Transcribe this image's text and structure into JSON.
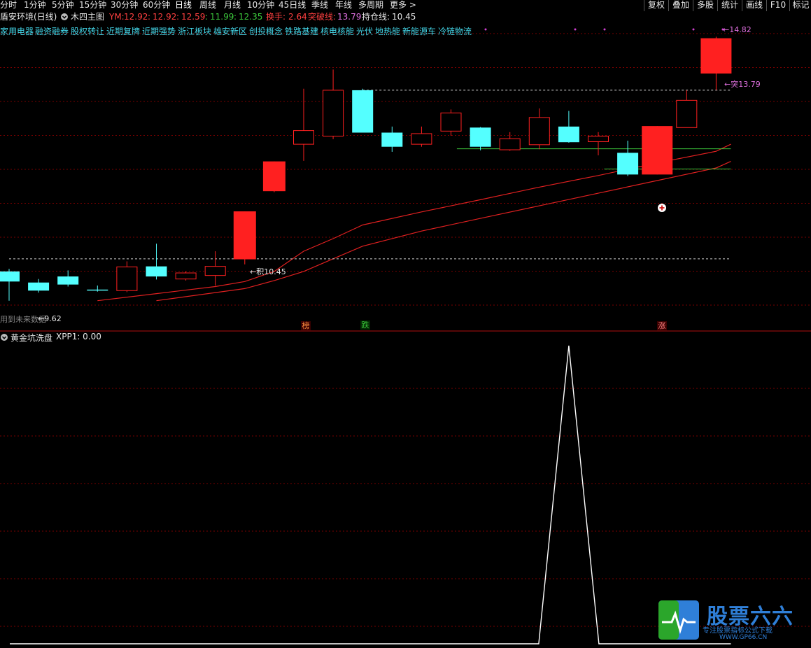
{
  "toolbar": {
    "periods": [
      "分时",
      "1分钟",
      "5分钟",
      "15分钟",
      "30分钟",
      "60分钟",
      "日线",
      "周线",
      "月线",
      "10分钟",
      "45日线",
      "季线",
      "年线",
      "多周期",
      "更多 >"
    ],
    "right_buttons": [
      "复权",
      "叠加",
      "多股",
      "统计",
      "画线",
      "F10",
      "标记"
    ]
  },
  "header": {
    "stock_title": "盾安环境(日线)",
    "indicator_name": "木四主图",
    "ym_label": "YM:",
    "ym_values": [
      "12.92",
      "12.92",
      "12.59",
      "11.99",
      "12.35"
    ],
    "turnover_label": "换手:",
    "turnover_value": "2.64",
    "breakout_label": "突破线:",
    "breakout_value": "13.79",
    "hold_label": "持仓线:",
    "hold_value": "10.45"
  },
  "concepts": [
    "家用电器",
    "融资融券",
    "股权转让",
    "近期复牌",
    "近期强势",
    "浙江板块",
    "雄安新区",
    "创投概念",
    "铁路基建",
    "核电核能",
    "光伏",
    "地热能",
    "新能源车",
    "冷链物流"
  ],
  "price_labels": {
    "high": "14.82",
    "breakout": "突13.79",
    "hold": "积10.45",
    "low": "9.62",
    "future_note": "用到未来数据"
  },
  "signals": {
    "s1": "榜",
    "s2": "跌",
    "s3": "涨"
  },
  "sub_chart": {
    "title": "黄金坑洗盘",
    "series_label": "XPP1: 0.00"
  },
  "logo": {
    "name": "股票六六",
    "tagline": "专注股票指标公式下载",
    "url": "WWW.GP66.CN"
  },
  "colors": {
    "up": "#ff2020",
    "down": "#54ffff",
    "grid": "#7a0000",
    "ma": "#e02020",
    "green_line": "#3cc83c",
    "white": "#ffffff"
  },
  "chart_data": [
    {
      "type": "candlestick",
      "title": "木四主图",
      "ylim": [
        9.2,
        15.3
      ],
      "candles": [
        {
          "o": 10.2,
          "c": 10.0,
          "h": 10.25,
          "l": 9.62
        },
        {
          "o": 9.98,
          "c": 9.82,
          "h": 10.05,
          "l": 9.78
        },
        {
          "o": 10.1,
          "c": 9.94,
          "h": 10.22,
          "l": 9.9
        },
        {
          "o": 9.84,
          "c": 9.82,
          "h": 9.92,
          "l": 9.8
        },
        {
          "o": 9.82,
          "c": 10.29,
          "h": 10.4,
          "l": 9.79
        },
        {
          "o": 10.3,
          "c": 10.1,
          "h": 10.75,
          "l": 10.04
        },
        {
          "o": 10.05,
          "c": 10.17,
          "h": 10.2,
          "l": 10.02
        },
        {
          "o": 10.12,
          "c": 10.3,
          "h": 10.6,
          "l": 9.92
        },
        {
          "o": 10.44,
          "c": 11.39,
          "h": 11.39,
          "l": 10.34
        },
        {
          "o": 11.79,
          "c": 12.38,
          "h": 12.38,
          "l": 11.77
        },
        {
          "o": 12.72,
          "c": 12.99,
          "h": 13.82,
          "l": 12.39
        },
        {
          "o": 12.88,
          "c": 13.79,
          "h": 14.2,
          "l": 12.82
        },
        {
          "o": 13.79,
          "c": 12.95,
          "h": 13.82,
          "l": 12.95
        },
        {
          "o": 12.95,
          "c": 12.67,
          "h": 13.07,
          "l": 12.57
        },
        {
          "o": 12.72,
          "c": 12.93,
          "h": 13.07,
          "l": 12.67
        },
        {
          "o": 12.98,
          "c": 13.34,
          "h": 13.41,
          "l": 12.89
        },
        {
          "o": 13.05,
          "c": 12.67,
          "h": 13.06,
          "l": 12.6
        },
        {
          "o": 12.61,
          "c": 12.83,
          "h": 12.96,
          "l": 12.59
        },
        {
          "o": 12.71,
          "c": 13.25,
          "h": 13.43,
          "l": 12.62
        },
        {
          "o": 13.07,
          "c": 12.76,
          "h": 13.38,
          "l": 12.75
        },
        {
          "o": 12.77,
          "c": 12.88,
          "h": 12.96,
          "l": 12.5
        },
        {
          "o": 12.55,
          "c": 12.12,
          "h": 12.79,
          "l": 12.09
        },
        {
          "o": 12.12,
          "c": 13.08,
          "h": 13.08,
          "l": 12.12
        },
        {
          "o": 13.05,
          "c": 13.59,
          "h": 13.79,
          "l": 13.05
        },
        {
          "o": 14.12,
          "c": 14.82,
          "h": 14.85,
          "l": 13.79
        }
      ],
      "breakout_line": 13.79,
      "hold_line": 10.45,
      "ma_fast": [
        [
          3,
          9.62
        ],
        [
          5,
          9.76
        ],
        [
          7,
          9.9
        ],
        [
          8,
          10.0
        ],
        [
          9,
          10.2
        ],
        [
          10,
          10.6
        ],
        [
          11,
          10.85
        ],
        [
          12,
          11.12
        ],
        [
          14,
          11.38
        ],
        [
          16,
          11.62
        ],
        [
          18,
          11.87
        ],
        [
          20,
          12.1
        ],
        [
          22,
          12.35
        ],
        [
          24,
          12.58
        ],
        [
          24.5,
          12.72
        ]
      ],
      "ma_slow": [
        [
          5,
          9.62
        ],
        [
          8,
          9.86
        ],
        [
          9,
          10.02
        ],
        [
          10,
          10.2
        ],
        [
          11,
          10.45
        ],
        [
          12,
          10.7
        ],
        [
          14,
          11.0
        ],
        [
          16,
          11.25
        ],
        [
          18,
          11.5
        ],
        [
          20,
          11.75
        ],
        [
          22,
          12.0
        ],
        [
          24,
          12.25
        ],
        [
          24.5,
          12.38
        ]
      ],
      "green_lines": [
        {
          "y": 12.63,
          "x1": 15.2,
          "x2": 24.5
        },
        {
          "y": 12.23,
          "x1": 20.2,
          "x2": 24.5
        }
      ]
    },
    {
      "type": "line",
      "title": "黄金坑洗盘",
      "series": [
        {
          "name": "XPP1",
          "values": [
            0,
            0,
            0,
            0,
            0,
            0,
            0,
            0,
            0,
            0,
            0,
            0,
            0,
            0,
            0,
            0,
            0,
            0,
            0,
            1,
            0,
            0,
            0,
            0,
            0
          ]
        }
      ],
      "ylim": [
        0,
        1
      ]
    }
  ]
}
